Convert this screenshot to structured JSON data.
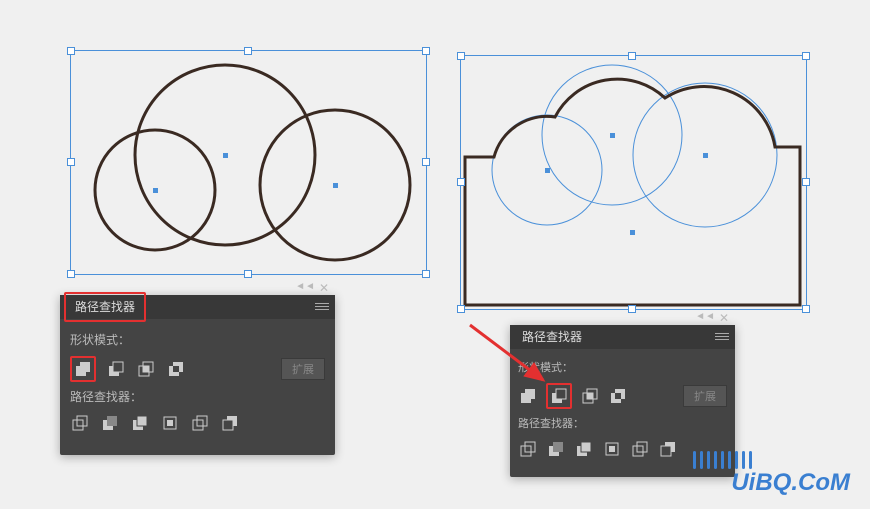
{
  "panel_left": {
    "tab": "路径查找器",
    "shape_mode_label": "形状模式：",
    "pathfinder_label": "路径查找器：",
    "expand_label": "扩展",
    "shape_icons": [
      "unite-icon",
      "minus-front-icon",
      "intersect-icon",
      "exclude-icon"
    ],
    "path_icons": [
      "divide-icon",
      "trim-icon",
      "merge-icon",
      "crop-icon",
      "outline-icon",
      "minus-back-icon"
    ]
  },
  "panel_right": {
    "tab": "路径查找器",
    "shape_mode_label": "形状模式：",
    "pathfinder_label": "路径查找器：",
    "expand_label": "扩展",
    "shape_icons": [
      "unite-icon",
      "minus-front-icon",
      "intersect-icon",
      "exclude-icon"
    ],
    "path_icons": [
      "divide-icon",
      "trim-icon",
      "merge-icon",
      "crop-icon",
      "outline-icon",
      "minus-back-icon"
    ]
  },
  "watermark": "UiBQ.CoM"
}
